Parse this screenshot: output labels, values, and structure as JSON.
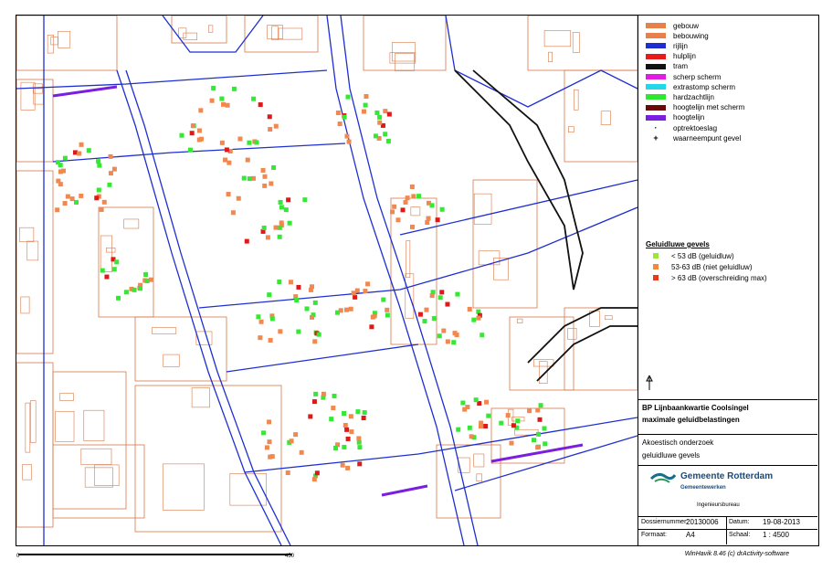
{
  "legend": {
    "items": [
      {
        "label": "gebouw",
        "color": "#e8804a",
        "kind": "swatch"
      },
      {
        "label": "bebouwing",
        "color": "#e8804a",
        "kind": "swatch"
      },
      {
        "label": "rijlijn",
        "color": "#1e2fd0",
        "kind": "swatch"
      },
      {
        "label": "hulplijn",
        "color": "#e81a1a",
        "kind": "swatch"
      },
      {
        "label": "tram",
        "color": "#111111",
        "kind": "swatch"
      },
      {
        "label": "scherp scherm",
        "color": "#e01ee0",
        "kind": "swatch"
      },
      {
        "label": "extrastomp scherm",
        "color": "#22d8e8",
        "kind": "swatch"
      },
      {
        "label": "hardzachtlijn",
        "color": "#2ee82e",
        "kind": "swatch"
      },
      {
        "label": "hoogtelijn met scherm",
        "color": "#6a0a0a",
        "kind": "swatch"
      },
      {
        "label": "hoogtelijn",
        "color": "#7a1ee0",
        "kind": "swatch"
      },
      {
        "label": "optrektoeslag",
        "symbol": "·",
        "kind": "symbol"
      },
      {
        "label": "waarneempunt gevel",
        "symbol": "+",
        "kind": "symbol"
      }
    ],
    "facade_title": "Geluidluwe gevels",
    "facade_items": [
      {
        "label": "< 53 dB (geluidluw)",
        "color": "#9ce63a"
      },
      {
        "label": "53-63 dB (niet geluidluw)",
        "color": "#f08a3c"
      },
      {
        "label": "> 63 dB (overschreiding max)",
        "color": "#e83a1a"
      }
    ],
    "colors": {
      "building": "#e07840",
      "road": "#1e2fd0",
      "green": "#34e834",
      "orange": "#f08850",
      "red": "#e01818",
      "outline": "#d87848"
    }
  },
  "title_block": {
    "line1": "BP Lijnbaankwartie Coolsingel",
    "line2": "maximale geluidbelastingen",
    "line3": "Akoestisch onderzoek",
    "line4": "geluidluwe gevels",
    "org_name": "Gemeente Rotterdam",
    "org_sub": "Gemeentewerken",
    "org_dept": "Ingenieursbureau",
    "dossier_label": "Dossiernummer:",
    "dossier_value": "20130006",
    "datum_label": "Datum:",
    "datum_value": "19-08-2013",
    "formaat_label": "Formaat:",
    "formaat_value": "A4",
    "schaal_label": "Schaal:",
    "schaal_value": "1 : 4500"
  },
  "scale": {
    "start": "0",
    "end": "450"
  },
  "credit": "WinHavik 8.46 (c) drActivity-software"
}
